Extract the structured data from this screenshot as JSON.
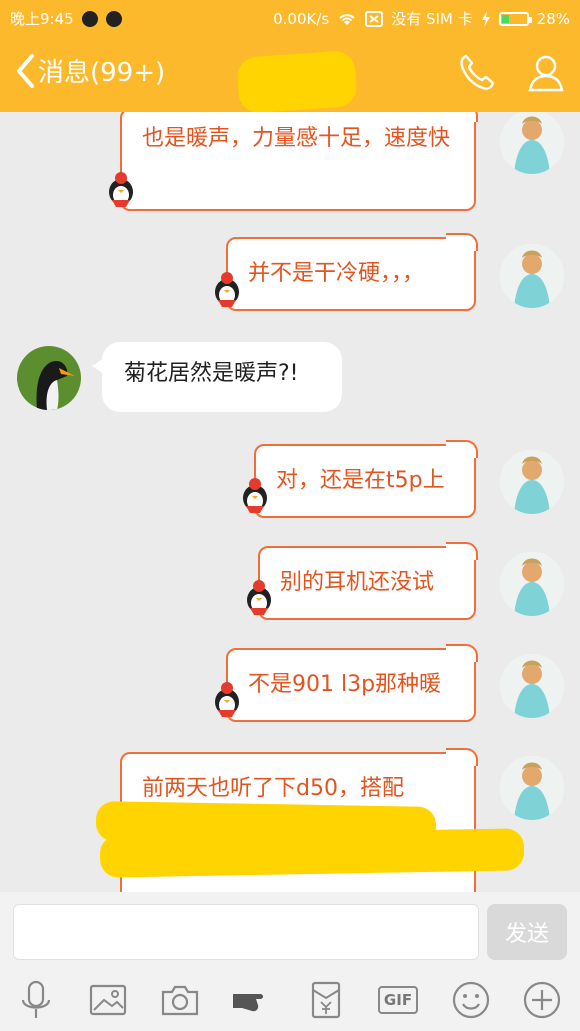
{
  "status": {
    "time": "晚上9:45",
    "network_speed": "0.00K/s",
    "no_sim": "没有 SIM 卡",
    "battery_percent": "28%",
    "battery_level": 0.28
  },
  "header": {
    "back_label": "消息(99+)"
  },
  "messages": [
    {
      "side": "out",
      "text": "也是暖声，力量感十足，速度快"
    },
    {
      "side": "out",
      "text": "并不是干冷硬，，，"
    },
    {
      "side": "in",
      "text": "菊花居然是暖声?!"
    },
    {
      "side": "out",
      "text": "对，还是在t5p上"
    },
    {
      "side": "out",
      "text": "别的耳机还没试"
    },
    {
      "side": "out",
      "text": "不是901 l3p那种暖"
    },
    {
      "side": "out",
      "text": "前两天也听了下d50，搭配"
    }
  ],
  "composer": {
    "input_value": "",
    "send_label": "发送"
  },
  "toolbar": {
    "icons": [
      "microphone-icon",
      "image-icon",
      "camera-icon",
      "pointer-hand-icon",
      "red-envelope-icon",
      "gif-icon",
      "emoji-icon",
      "plus-icon"
    ],
    "gif_label": "GIF"
  },
  "colors": {
    "brand": "#fdb92c",
    "bubble_border": "#f06e3a",
    "bubble_text": "#e4541e",
    "redaction": "#ffd400"
  }
}
